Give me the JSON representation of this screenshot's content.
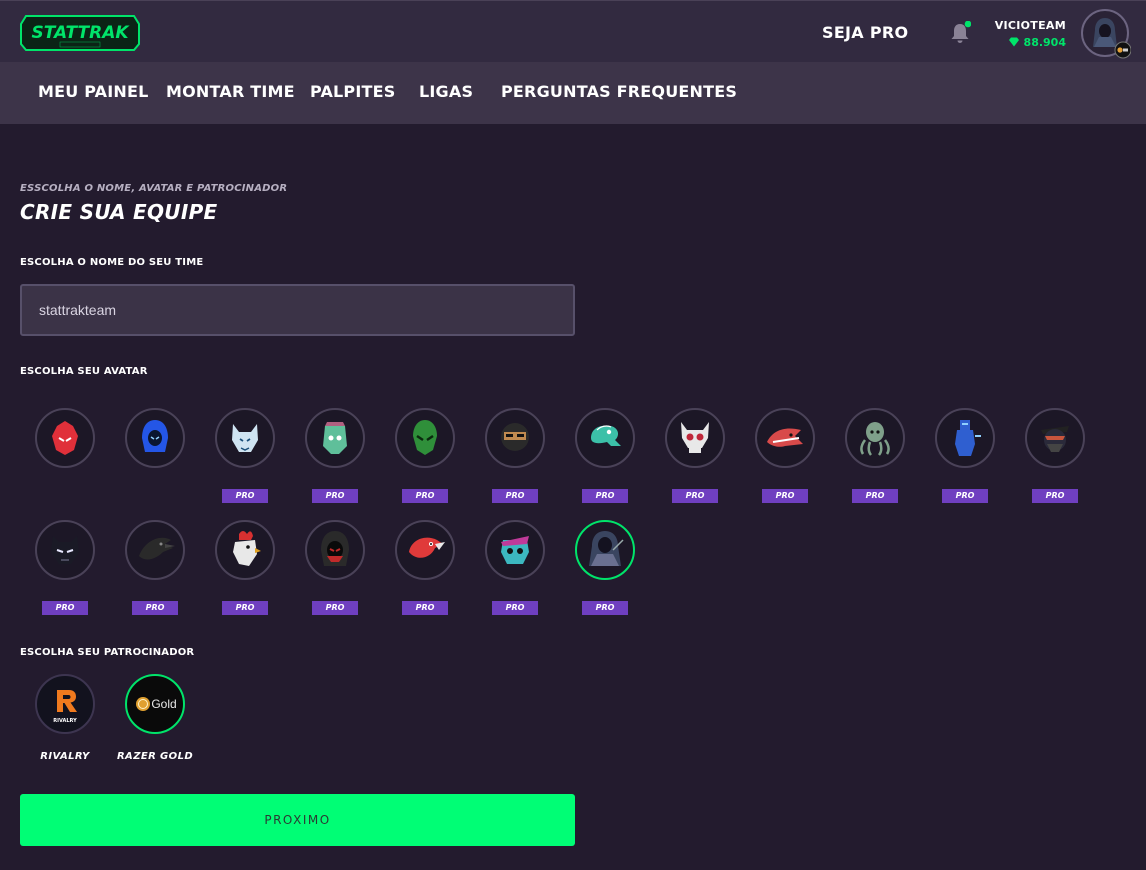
{
  "header": {
    "logo_text": "STATTRAK",
    "seja_pro_label": "SEJA PRO",
    "user_name": "VICIOTEAM",
    "user_points": "88.904",
    "notification_icon": "bell-icon",
    "points_icon": "diamond-icon"
  },
  "nav": {
    "items": [
      {
        "label": "MEU PAINEL"
      },
      {
        "label": "MONTAR TIME"
      },
      {
        "label": "PALPITES"
      },
      {
        "label": "LIGAS"
      },
      {
        "label": "PERGUNTAS FREQUENTES"
      }
    ]
  },
  "page": {
    "subtitle": "ESSCOLHA O NOME, AVATAR E PATROCINADOR",
    "title": "CRIE SUA EQUIPE"
  },
  "team_name": {
    "label": "ESCOLHA O NOME DO SEU TIME",
    "value": "stattrakteam"
  },
  "avatars": {
    "label": "ESCOLHA SEU AVATAR",
    "pro_label": "PRO",
    "selected_index": 18,
    "items": [
      {
        "name": "red-demon",
        "pro": false,
        "color": "#e0303a"
      },
      {
        "name": "blue-hood",
        "pro": false,
        "color": "#2456e6"
      },
      {
        "name": "white-wolf",
        "pro": true,
        "color": "#cfe4f2"
      },
      {
        "name": "green-zombie",
        "pro": true,
        "color": "#5fbf9a"
      },
      {
        "name": "green-alien",
        "pro": true,
        "color": "#2f8f3a"
      },
      {
        "name": "masked-soldier",
        "pro": true,
        "color": "#c08a50"
      },
      {
        "name": "teal-snake",
        "pro": true,
        "color": "#3cc0a8"
      },
      {
        "name": "skull-devil",
        "pro": true,
        "color": "#e8e8e8"
      },
      {
        "name": "shark",
        "pro": true,
        "color": "#d84a4a"
      },
      {
        "name": "kraken",
        "pro": true,
        "color": "#7fa08a"
      },
      {
        "name": "blue-knight",
        "pro": true,
        "color": "#2f5fd0"
      },
      {
        "name": "bandit",
        "pro": true,
        "color": "#c8553d"
      },
      {
        "name": "black-panther",
        "pro": true,
        "color": "#5a5a70"
      },
      {
        "name": "black-crow",
        "pro": true,
        "color": "#2a2a2a"
      },
      {
        "name": "rooster",
        "pro": true,
        "color": "#e8e8e8"
      },
      {
        "name": "dark-assassin",
        "pro": true,
        "color": "#c02a2a"
      },
      {
        "name": "red-bird",
        "pro": true,
        "color": "#e03a3a"
      },
      {
        "name": "cyber-skull",
        "pro": true,
        "color": "#3cb8c0"
      },
      {
        "name": "hooded-reaper",
        "pro": true,
        "color": "#6a7090"
      }
    ]
  },
  "sponsors": {
    "label": "ESCOLHA SEU PATROCINADOR",
    "selected_index": 1,
    "items": [
      {
        "name": "RIVALRY",
        "logo_text": "RIVALRY"
      },
      {
        "name": "RAZER GOLD",
        "logo_text": "Gold"
      }
    ]
  },
  "next_button": {
    "label": "PROXIMO"
  },
  "colors": {
    "accent": "#00fe75",
    "pro_badge": "#6f3fc0",
    "selected_ring": "#00e46a"
  }
}
